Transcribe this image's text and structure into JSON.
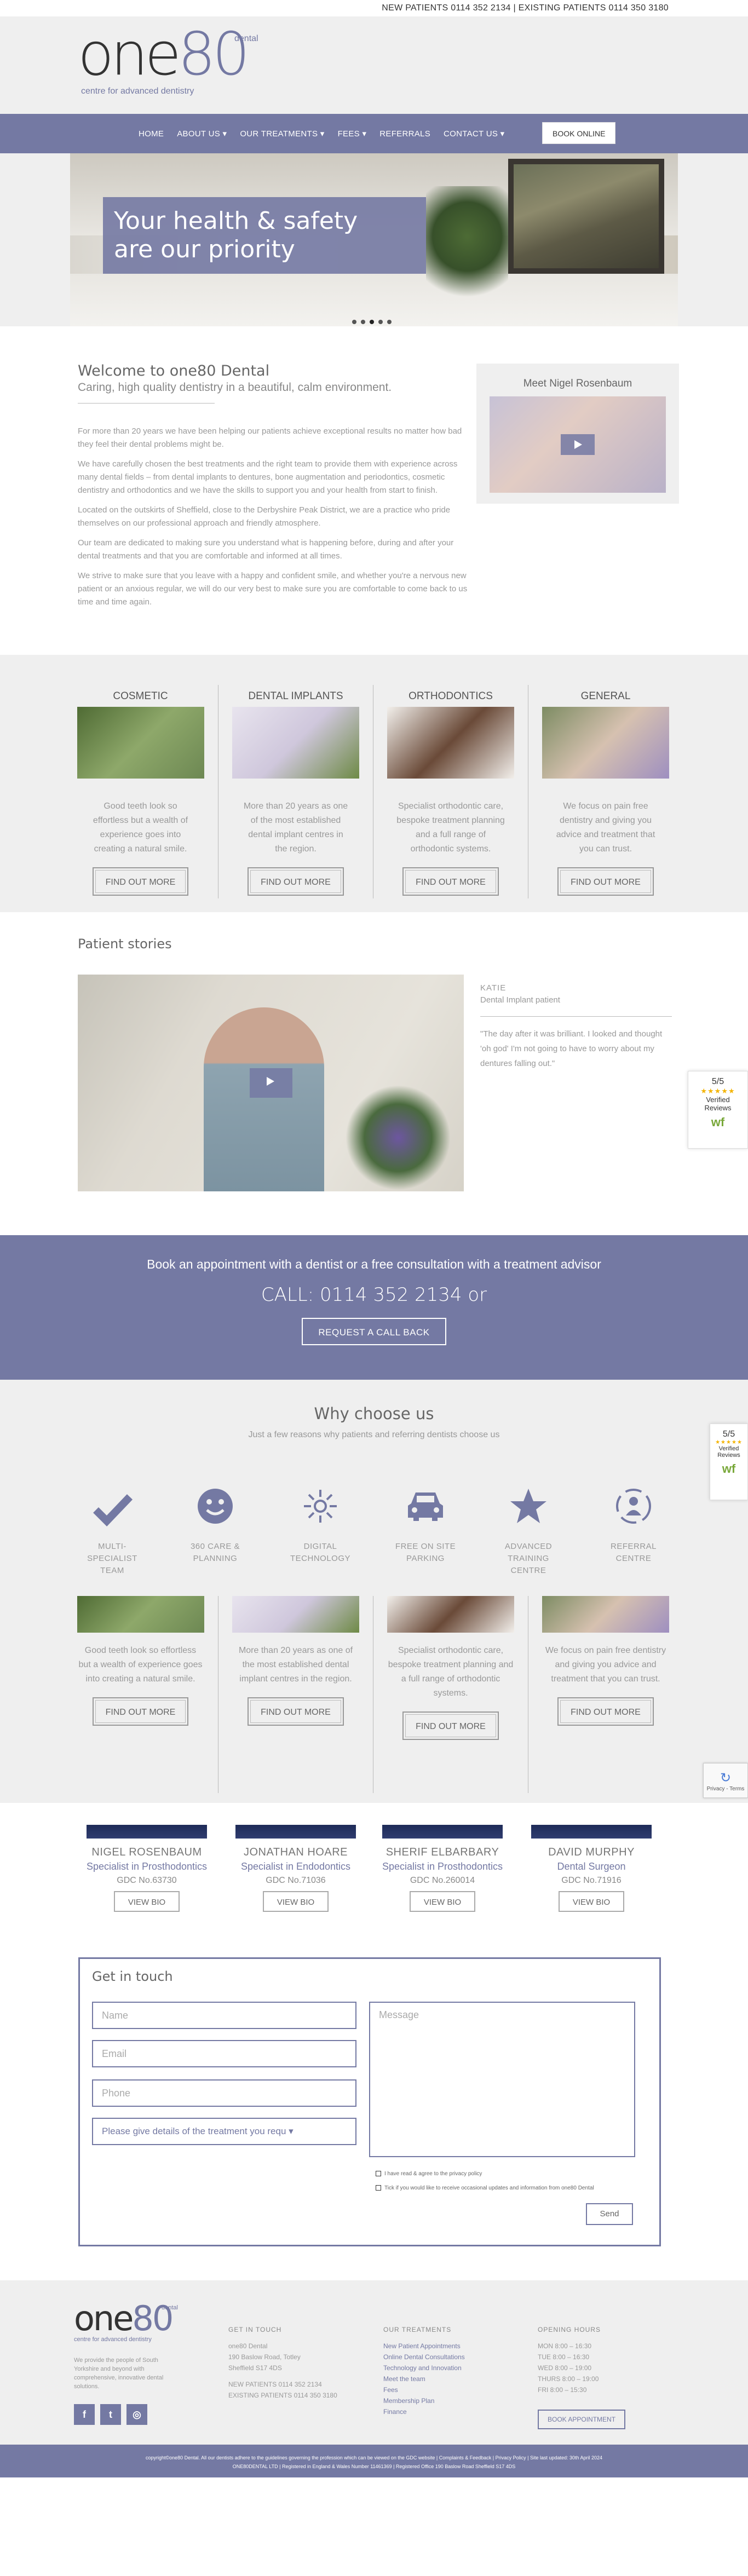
{
  "topbar": {
    "phones": "NEW PATIENTS 0114 352 2134 | EXISTING PATIENTS 0114 350 3180"
  },
  "logo": {
    "one": "one",
    "eighty": "80",
    "dental": "dental",
    "tagline": "centre for advanced dentistry"
  },
  "nav": {
    "items": [
      "HOME",
      "ABOUT US ▾",
      "OUR TREATMENTS ▾",
      "FEES ▾",
      "REFERRALS",
      "CONTACT US ▾"
    ],
    "book": "BOOK ONLINE"
  },
  "hero": {
    "caption_line1": "Your health & safety",
    "caption_line2": "are our priority"
  },
  "welcome": {
    "title": "Welcome to one80 Dental",
    "subtitle": "Caring, high quality dentistry in a beautiful, calm environment.",
    "paragraphs": [
      "For more than 20 years we have been helping our patients achieve exceptional results no matter how bad they feel their dental problems might be.",
      "We have carefully chosen the best treatments and the right team to provide them with experience across many dental fields – from dental implants to dentures, bone augmentation and periodontics, cosmetic dentistry and orthodontics and we have the skills to support you and your health from start to finish.",
      "Located on the outskirts of Sheffield, close to the Derbyshire Peak District, we are a practice who pride themselves on our professional approach and friendly atmosphere.",
      "Our team are dedicated to making sure you understand what is happening before, during and after your dental treatments and that you are comfortable and informed at all times.",
      "We strive to make sure that you leave with a happy and confident smile, and whether you're a nervous new patient or an anxious regular, we will do our very best to make sure you are comfortable to come back to us time and time again."
    ],
    "meet": "Meet Nigel Rosenbaum"
  },
  "services": [
    {
      "title": "COSMETIC",
      "text": "Good teeth look so effortless but a wealth of experience goes into creating a natural smile.",
      "button": "FIND OUT MORE"
    },
    {
      "title": "DENTAL IMPLANTS",
      "text": "More than 20 years as one of the most established dental implant centres in the region.",
      "button": "FIND OUT MORE"
    },
    {
      "title": "ORTHODONTICS",
      "text": "Specialist orthodontic care, bespoke treatment planning and a full range of orthodontic systems.",
      "button": "FIND OUT MORE"
    },
    {
      "title": "GENERAL",
      "text": "We focus on pain free dentistry and giving you advice and treatment that you can trust.",
      "button": "FIND OUT MORE"
    }
  ],
  "stories": {
    "title": "Patient stories",
    "name": "KATIE",
    "role": "Dental Implant patient",
    "quote": "\"The day after it was brilliant. I looked and thought 'oh god' I'm not going to have to worry about my dentures falling out.\""
  },
  "badge": {
    "score": "5/5",
    "stars": "★★★★★",
    "verified": "Verified",
    "reviews": "Reviews",
    "wf": "wf"
  },
  "book": {
    "headline": "Book an appointment with a dentist or a free consultation with a treatment advisor",
    "call": "CALL: 0114 352 2134 or",
    "button": "REQUEST A CALL BACK"
  },
  "why": {
    "title": "Why choose us",
    "subtitle": "Just a few reasons why patients and referring dentists choose us",
    "features": [
      "MULTI-\nSPECIALIST\nTEAM",
      "360 CARE &\nPLANNING",
      "DIGITAL\nTECHNOLOGY",
      "FREE ON SITE\nPARKING",
      "ADVANCED\nTRAINING\nCENTRE",
      "REFERRAL\nCENTRE"
    ],
    "feature_icons": [
      "check-icon",
      "smile-icon",
      "digital-icon",
      "car-icon",
      "star-icon",
      "referral-icon"
    ]
  },
  "team": [
    {
      "name": "NIGEL ROSENBAUM",
      "role": "Specialist in Prosthodontics",
      "gdc": "GDC No.63730",
      "button": "VIEW BIO"
    },
    {
      "name": "JONATHAN HOARE",
      "role": "Specialist in Endodontics",
      "gdc": "GDC No.71036",
      "button": "VIEW BIO"
    },
    {
      "name": "SHERIF ELBARBARY",
      "role": "Specialist in Prosthodontics",
      "gdc": "GDC No.260014",
      "button": "VIEW BIO"
    },
    {
      "name": "DAVID MURPHY",
      "role": "Dental Surgeon",
      "gdc": "GDC No.71916",
      "button": "VIEW BIO"
    }
  ],
  "contact": {
    "title": "Get in touch",
    "name_placeholder": "Name",
    "email_placeholder": "Email",
    "phone_placeholder": "Phone",
    "treatment_placeholder": "Please give details of the treatment you requ ▾",
    "message_placeholder": "Message",
    "consent1": "I have read & agree to the privacy policy",
    "consent2": "Tick if you would like to receive occasional updates and information from one80 Dental",
    "send": "Send"
  },
  "footer": {
    "about": "We provide the people of South Yorkshire and beyond with comprehensive, innovative dental solutions.",
    "get_in_touch_h": "GET IN TOUCH",
    "address": [
      "one80 Dental",
      "190 Baslow Road, Totley",
      "Sheffield S17 4DS"
    ],
    "phones": [
      "NEW PATIENTS 0114 352 2134",
      "EXISTING PATIENTS 0114 350 3180"
    ],
    "treatments_h": "OUR TREATMENTS",
    "treatments": [
      "New Patient Appointments",
      "Online Dental Consultations",
      "Technology and Innovation",
      "Meet the team",
      "Fees",
      "Membership Plan",
      "Finance"
    ],
    "hours_h": "OPENING HOURS",
    "hours": [
      "MON 8:00 – 16:30",
      "TUE 8:00 – 16:30",
      "WED 8:00 – 19:00",
      "THURS 8:00 – 19:00",
      "FRI 8:00 – 15:30"
    ],
    "book": "BOOK APPOINTMENT",
    "copy1": "copyright©one80 Dental. All our dentists adhere to the guidelines governing the profession which can be viewed on the GDC website | Complaints & Feedback | Privacy Policy | Site last updated: 30th April 2024",
    "copy2": "ONE80DENTAL LTD | Registered in England & Wales Number 11461369 | Registered Office 190 Baslow Road Sheffield S17 4DS"
  },
  "recaptcha": {
    "text": "Privacy - Terms"
  },
  "colors": {
    "brand": "#7479a3",
    "background": "#efefef"
  }
}
